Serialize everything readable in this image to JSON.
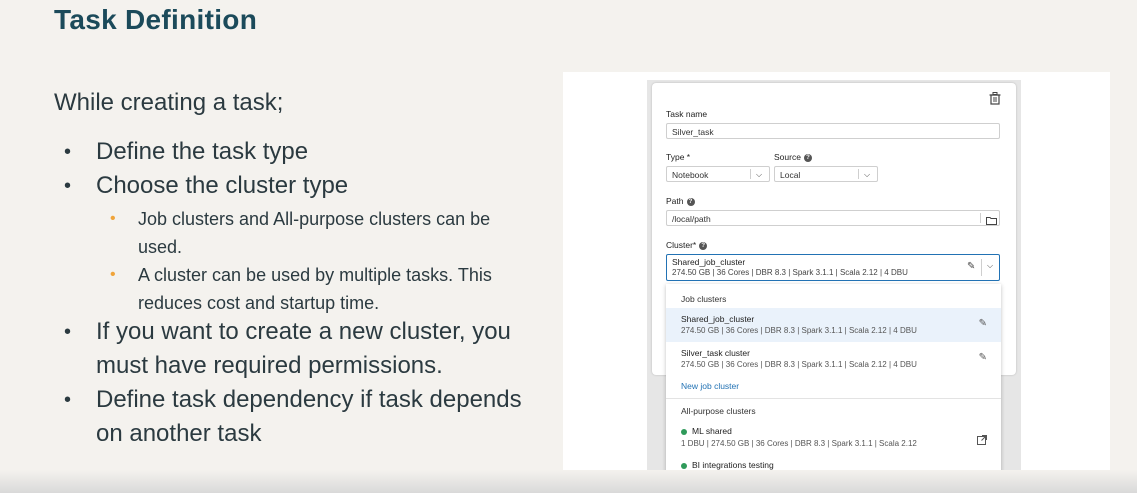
{
  "slide": {
    "title": "Task Definition",
    "intro": "While creating a task;",
    "bullets": [
      "Define the task type",
      "Choose the cluster type",
      "If you want to create a new cluster, you must have required permissions.",
      "Define task dependency if task depends on another task"
    ],
    "sub_bullets": [
      "Job clusters and All-purpose clusters can be used.",
      "A cluster can be used by multiple tasks. This reduces cost and startup time."
    ]
  },
  "form": {
    "task_name_label": "Task name",
    "task_name_value": "Silver_task",
    "type_label": "Type *",
    "type_value": "Notebook",
    "source_label": "Source",
    "source_value": "Local",
    "path_label": "Path",
    "path_value": "/local/path",
    "cluster_label": "Cluster*",
    "cluster_name": "Shared_job_cluster",
    "cluster_meta": "274.50 GB | 36 Cores | DBR 8.3 | Spark 3.1.1 | Scala 2.12 | 4 DBU"
  },
  "dropdown": {
    "job_clusters_header": "Job clusters",
    "job_clusters": [
      {
        "name": "Shared_job_cluster",
        "meta": "274.50 GB | 36 Cores | DBR 8.3 | Spark 3.1.1 | Scala 2.12 | 4 DBU"
      },
      {
        "name": "Silver_task cluster",
        "meta": "274.50 GB | 36 Cores | DBR 8.3 | Spark 3.1.1 | Scala 2.12 | 4 DBU"
      }
    ],
    "new_job_cluster": "New job cluster",
    "all_purpose_header": "All-purpose clusters",
    "all_purpose": [
      {
        "name": "ML shared",
        "meta": "1 DBU | 274.50 GB | 36 Cores | DBR 8.3 | Spark 3.1.1 | Scala 2.12"
      },
      {
        "name": "BI integrations testing"
      }
    ],
    "status_color": "#2f9a5a",
    "link_color": "#2272b4"
  }
}
